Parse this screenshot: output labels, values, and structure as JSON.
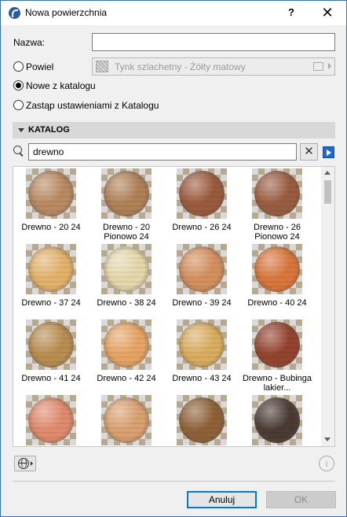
{
  "window": {
    "title": "Nowa powierzchnia",
    "help_label": "?",
    "close_label": "✕"
  },
  "form": {
    "name_label": "Nazwa:",
    "name_value": "",
    "duplicate_label": "Powiel",
    "duplicate_surface": "Tynk szlachetny - Żółty matowy",
    "new_from_catalog_label": "Nowe z katalogu",
    "replace_label": "Zastąp ustawieniami z Katalogu",
    "selected_option": "new_from_catalog"
  },
  "catalog": {
    "section_label": "KATALOG",
    "search_value": "drewno",
    "clear_label": "✕",
    "items": [
      {
        "name": "Drewno - 20 24",
        "color": "#b98a62"
      },
      {
        "name": "Drewno - 20 Pionowo 24",
        "color": "#b08057"
      },
      {
        "name": "Drewno - 26 24",
        "color": "#9b5a3c"
      },
      {
        "name": "Drewno - 26 Pionowo 24",
        "color": "#9a5c40"
      },
      {
        "name": "Drewno - 37 24",
        "color": "#e2b26b"
      },
      {
        "name": "Drewno - 38 24",
        "color": "#e5d7ab"
      },
      {
        "name": "Drewno - 39 24",
        "color": "#d38f5d"
      },
      {
        "name": "Drewno - 40 24",
        "color": "#d8763b"
      },
      {
        "name": "Drewno - 41 24",
        "color": "#b98d50"
      },
      {
        "name": "Drewno - 42 24",
        "color": "#e6a464"
      },
      {
        "name": "Drewno - 43 24",
        "color": "#d9ad5f"
      },
      {
        "name": "Drewno - Bubinga lakier...",
        "color": "#94432e"
      },
      {
        "name": "",
        "color": "#e08a6c"
      },
      {
        "name": "",
        "color": "#d9a070"
      },
      {
        "name": "",
        "color": "#8f6138"
      },
      {
        "name": "",
        "color": "#4a3a33"
      }
    ]
  },
  "footer": {
    "info_label": "i",
    "cancel_label": "Anuluj",
    "ok_label": "OK"
  }
}
